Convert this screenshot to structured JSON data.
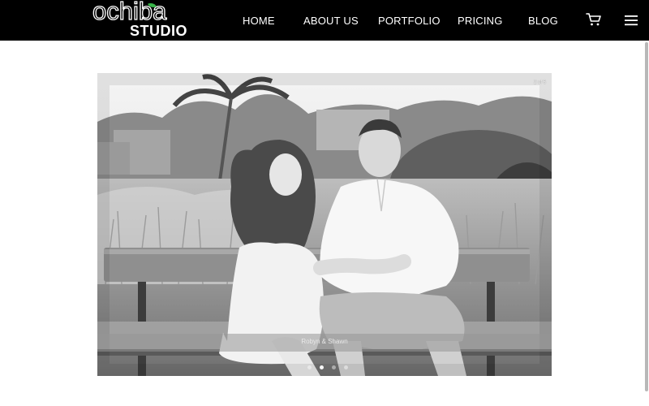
{
  "brand": {
    "name_top": "ochiba",
    "name_bottom": "STUDIO",
    "accent": "#39b54a"
  },
  "nav": {
    "items": [
      {
        "label": "HOME"
      },
      {
        "label": "ABOUT US"
      },
      {
        "label": "PORTFOLIO"
      },
      {
        "label": "PRICING"
      },
      {
        "label": "BLOG"
      }
    ],
    "cart_icon": "shopping-cart-icon",
    "menu_icon": "hamburger-menu-icon"
  },
  "slider": {
    "counter": "2 of 6",
    "caption": "Robyn & Shawn",
    "photo_alt": "Black and white photo of a couple sitting on a wooden bench",
    "total_slides": 6,
    "active_slide": 2,
    "visible_dots": 4
  },
  "colors": {
    "header_bg": "#000000",
    "page_bg": "#ffffff",
    "nav_text": "#ffffff"
  }
}
